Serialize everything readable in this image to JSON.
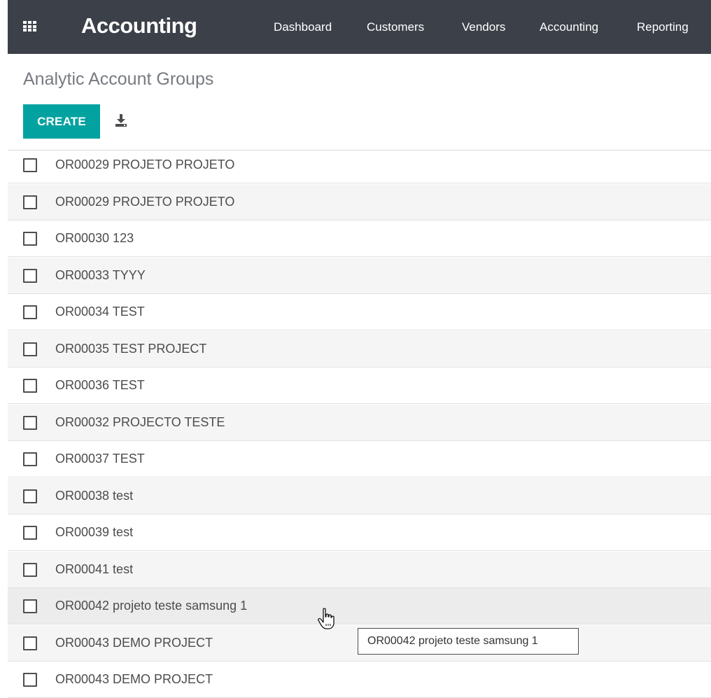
{
  "navbar": {
    "app_icon": "apps-grid-icon",
    "brand": "Accounting",
    "menu": [
      "Dashboard",
      "Customers",
      "Vendors",
      "Accounting",
      "Reporting"
    ],
    "background": "#3c4049"
  },
  "page": {
    "title": "Analytic Account Groups"
  },
  "toolbar": {
    "create_label": "CREATE",
    "download_icon": "download-icon",
    "accent": "#02a2a0"
  },
  "list": {
    "rows": [
      "OR00029 PROJETO PROJETO",
      "OR00029 PROJETO PROJETO",
      "OR00030 123",
      "OR00033 TYYY",
      "OR00034 TEST",
      "OR00035 TEST PROJECT",
      "OR00036 TEST",
      "OR00032 PROJECTO TESTE",
      "OR00037 TEST",
      "OR00038 test",
      "OR00039 test",
      "OR00041 test",
      "OR00042 projeto teste samsung 1",
      "OR00043 DEMO PROJECT",
      "OR00043 DEMO PROJECT"
    ],
    "hovered_row": 12
  },
  "tooltip": {
    "text": "OR00042 projeto teste samsung 1"
  },
  "cursor": "hand-pointer-icon"
}
